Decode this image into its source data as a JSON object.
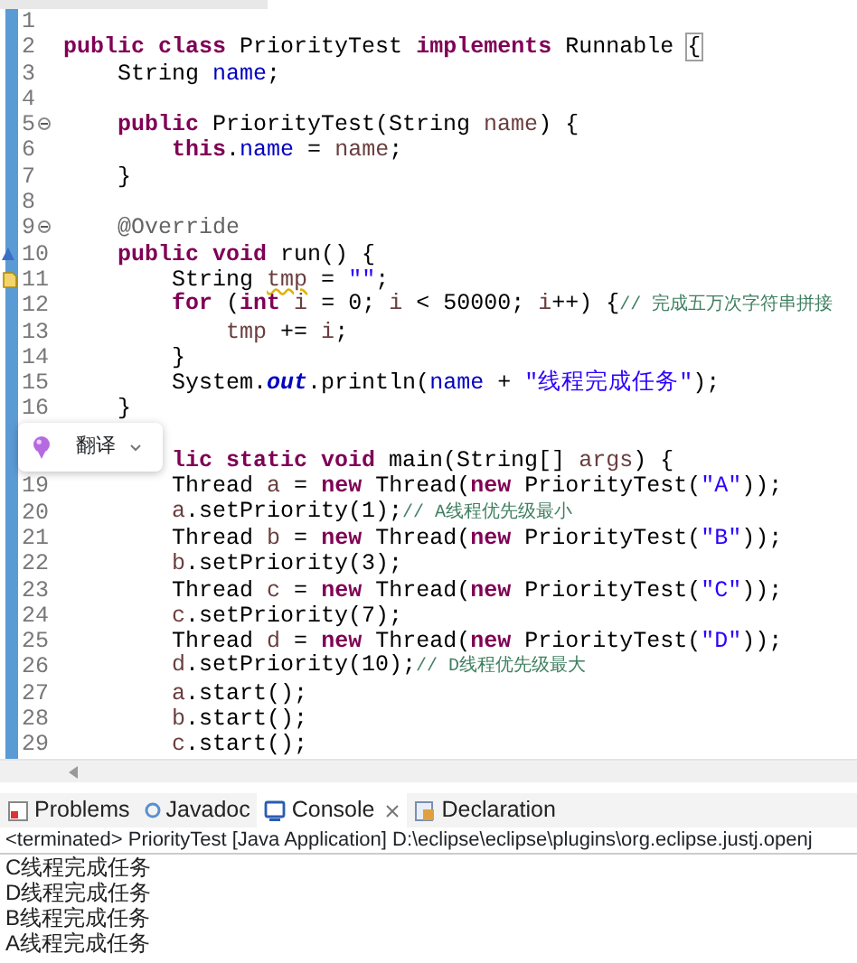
{
  "editor": {
    "lines": [
      {
        "kind": "code",
        "number": "1"
      },
      {
        "kind": "code",
        "number": "2",
        "tokens": [
          {
            "kind": "kw",
            "text": "public class "
          },
          {
            "kind": "plain",
            "text": "PriorityTest "
          },
          {
            "kind": "kw",
            "text": "implements "
          },
          {
            "kind": "plain",
            "text": "Runnable "
          },
          {
            "kind": "bracket_match",
            "text": "{"
          }
        ]
      },
      {
        "kind": "code",
        "number": "3",
        "tokens": [
          {
            "kind": "plain",
            "text": "    String "
          },
          {
            "kind": "field",
            "text": "name"
          },
          {
            "kind": "plain",
            "text": ";"
          }
        ]
      },
      {
        "kind": "code",
        "number": "4"
      },
      {
        "kind": "code",
        "number": "5",
        "fold_expanded": true,
        "tokens": [
          {
            "kind": "kw",
            "text": "    public "
          },
          {
            "kind": "plain",
            "text": "PriorityTest(String "
          },
          {
            "kind": "local",
            "text": "name"
          },
          {
            "kind": "plain",
            "text": ") {"
          }
        ]
      },
      {
        "kind": "code",
        "number": "6",
        "tokens": [
          {
            "kind": "kw",
            "text": "        this"
          },
          {
            "kind": "plain",
            "text": "."
          },
          {
            "kind": "field",
            "text": "name"
          },
          {
            "kind": "plain",
            "text": " = "
          },
          {
            "kind": "local",
            "text": "name"
          },
          {
            "kind": "plain",
            "text": ";"
          }
        ]
      },
      {
        "kind": "code",
        "number": "7",
        "tokens": [
          {
            "kind": "plain",
            "text": "    }"
          }
        ]
      },
      {
        "kind": "code",
        "number": "8"
      },
      {
        "kind": "code",
        "number": "9",
        "fold_expanded": true,
        "tokens": [
          {
            "kind": "annotation",
            "text": "    @Override"
          }
        ]
      },
      {
        "kind": "code",
        "number": "10",
        "override": true,
        "tokens": [
          {
            "kind": "kw",
            "text": "    public void "
          },
          {
            "kind": "plain",
            "text": "run() {"
          }
        ]
      },
      {
        "kind": "code",
        "number": "11",
        "warning": true,
        "tokens": [
          {
            "kind": "plain",
            "text": "        String "
          },
          {
            "kind": "local_warn",
            "text": "tmp"
          },
          {
            "kind": "plain",
            "text": " = "
          },
          {
            "kind": "string",
            "text": "\"\""
          },
          {
            "kind": "plain",
            "text": ";"
          }
        ]
      },
      {
        "kind": "code",
        "number": "12",
        "tokens": [
          {
            "kind": "kw",
            "text": "        for "
          },
          {
            "kind": "plain",
            "text": "("
          },
          {
            "kind": "kw",
            "text": "int "
          },
          {
            "kind": "local",
            "text": "i"
          },
          {
            "kind": "plain",
            "text": " = 0; "
          },
          {
            "kind": "local",
            "text": "i"
          },
          {
            "kind": "plain",
            "text": " < 50000; "
          },
          {
            "kind": "local",
            "text": "i"
          },
          {
            "kind": "plain",
            "text": "++) {"
          },
          {
            "kind": "comment",
            "text": "// 完成五万次字符串拼接"
          }
        ]
      },
      {
        "kind": "code",
        "number": "13",
        "tokens": [
          {
            "kind": "local",
            "text": "            tmp"
          },
          {
            "kind": "plain",
            "text": " += "
          },
          {
            "kind": "local",
            "text": "i"
          },
          {
            "kind": "plain",
            "text": ";"
          }
        ]
      },
      {
        "kind": "code",
        "number": "14",
        "tokens": [
          {
            "kind": "plain",
            "text": "        }"
          }
        ]
      },
      {
        "kind": "code",
        "number": "15",
        "tokens": [
          {
            "kind": "plain",
            "text": "        System."
          },
          {
            "kind": "static_field",
            "text": "out"
          },
          {
            "kind": "plain",
            "text": ".println("
          },
          {
            "kind": "field",
            "text": "name"
          },
          {
            "kind": "plain",
            "text": " + "
          },
          {
            "kind": "string",
            "text": "\"线程完成任务\""
          },
          {
            "kind": "plain",
            "text": ");"
          }
        ]
      },
      {
        "kind": "code",
        "number": "16",
        "tokens": [
          {
            "kind": "plain",
            "text": "    }"
          }
        ]
      },
      {
        "kind": "blank"
      },
      {
        "kind": "code",
        "tokens": [
          {
            "kind": "kw",
            "text": "        lic static void "
          },
          {
            "kind": "plain",
            "text": "main(String[] "
          },
          {
            "kind": "local",
            "text": "args"
          },
          {
            "kind": "plain",
            "text": ") {"
          }
        ]
      },
      {
        "kind": "code",
        "number": "19",
        "tokens": [
          {
            "kind": "plain",
            "text": "        Thread "
          },
          {
            "kind": "local",
            "text": "a"
          },
          {
            "kind": "plain",
            "text": " = "
          },
          {
            "kind": "kw",
            "text": "new "
          },
          {
            "kind": "plain",
            "text": "Thread("
          },
          {
            "kind": "kw",
            "text": "new "
          },
          {
            "kind": "plain",
            "text": "PriorityTest("
          },
          {
            "kind": "string",
            "text": "\"A\""
          },
          {
            "kind": "plain",
            "text": "));"
          }
        ]
      },
      {
        "kind": "code",
        "number": "20",
        "tokens": [
          {
            "kind": "local",
            "text": "        a"
          },
          {
            "kind": "plain",
            "text": ".setPriority(1);"
          },
          {
            "kind": "comment",
            "text": "// A线程优先级最小"
          }
        ]
      },
      {
        "kind": "code",
        "number": "21",
        "tokens": [
          {
            "kind": "plain",
            "text": "        Thread "
          },
          {
            "kind": "local",
            "text": "b"
          },
          {
            "kind": "plain",
            "text": " = "
          },
          {
            "kind": "kw",
            "text": "new "
          },
          {
            "kind": "plain",
            "text": "Thread("
          },
          {
            "kind": "kw",
            "text": "new "
          },
          {
            "kind": "plain",
            "text": "PriorityTest("
          },
          {
            "kind": "string",
            "text": "\"B\""
          },
          {
            "kind": "plain",
            "text": "));"
          }
        ]
      },
      {
        "kind": "code",
        "number": "22",
        "tokens": [
          {
            "kind": "local",
            "text": "        b"
          },
          {
            "kind": "plain",
            "text": ".setPriority(3);"
          }
        ]
      },
      {
        "kind": "code",
        "number": "23",
        "tokens": [
          {
            "kind": "plain",
            "text": "        Thread "
          },
          {
            "kind": "local",
            "text": "c"
          },
          {
            "kind": "plain",
            "text": " = "
          },
          {
            "kind": "kw",
            "text": "new "
          },
          {
            "kind": "plain",
            "text": "Thread("
          },
          {
            "kind": "kw",
            "text": "new "
          },
          {
            "kind": "plain",
            "text": "PriorityTest("
          },
          {
            "kind": "string",
            "text": "\"C\""
          },
          {
            "kind": "plain",
            "text": "));"
          }
        ]
      },
      {
        "kind": "code",
        "number": "24",
        "tokens": [
          {
            "kind": "local",
            "text": "        c"
          },
          {
            "kind": "plain",
            "text": ".setPriority(7);"
          }
        ]
      },
      {
        "kind": "code",
        "number": "25",
        "tokens": [
          {
            "kind": "plain",
            "text": "        Thread "
          },
          {
            "kind": "local",
            "text": "d"
          },
          {
            "kind": "plain",
            "text": " = "
          },
          {
            "kind": "kw",
            "text": "new "
          },
          {
            "kind": "plain",
            "text": "Thread("
          },
          {
            "kind": "kw",
            "text": "new "
          },
          {
            "kind": "plain",
            "text": "PriorityTest("
          },
          {
            "kind": "string",
            "text": "\"D\""
          },
          {
            "kind": "plain",
            "text": "));"
          }
        ]
      },
      {
        "kind": "code",
        "number": "26",
        "tokens": [
          {
            "kind": "local",
            "text": "        d"
          },
          {
            "kind": "plain",
            "text": ".setPriority(10);"
          },
          {
            "kind": "comment",
            "text": "// D线程优先级最大"
          }
        ]
      },
      {
        "kind": "code",
        "number": "27",
        "tokens": [
          {
            "kind": "local",
            "text": "        a"
          },
          {
            "kind": "plain",
            "text": ".start();"
          }
        ]
      },
      {
        "kind": "code",
        "number": "28",
        "tokens": [
          {
            "kind": "local",
            "text": "        b"
          },
          {
            "kind": "plain",
            "text": ".start();"
          }
        ]
      },
      {
        "kind": "code",
        "number": "29",
        "tokens": [
          {
            "kind": "local",
            "text": "        c"
          },
          {
            "kind": "plain",
            "text": ".start();"
          }
        ]
      }
    ]
  },
  "popup": {
    "label": "翻译"
  },
  "views": {
    "tabs": [
      {
        "label": "Problems",
        "selected": false,
        "closable": false
      },
      {
        "label": "Javadoc",
        "selected": false,
        "closable": false
      },
      {
        "label": "Console",
        "selected": true,
        "closable": true
      },
      {
        "label": "Declaration",
        "selected": false,
        "closable": false
      }
    ],
    "console": {
      "header": "<terminated> PriorityTest [Java Application] D:\\eclipse\\eclipse\\plugins\\org.eclipse.justj.openj",
      "output": [
        "C线程完成任务",
        "D线程完成任务",
        "B线程完成任务",
        "A线程完成任务"
      ]
    }
  }
}
